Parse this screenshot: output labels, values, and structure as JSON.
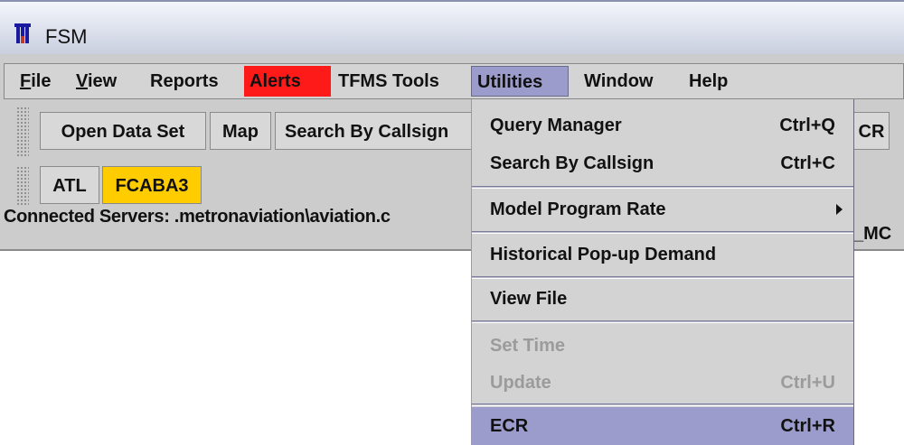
{
  "window": {
    "title": "FSM"
  },
  "menubar": {
    "items": [
      {
        "label": "File",
        "mnemonic_underline": true
      },
      {
        "label": "View",
        "mnemonic_underline": true
      },
      {
        "label": "Reports"
      },
      {
        "label": "Alerts"
      },
      {
        "label": "TFMS Tools"
      },
      {
        "label": "Utilities"
      },
      {
        "label": "Window"
      },
      {
        "label": "Help"
      }
    ]
  },
  "toolbar": {
    "open_data_set": "Open Data Set",
    "map": "Map",
    "search_by_callsign": "Search By Callsign",
    "ecr_partial": "CR"
  },
  "tabs": [
    {
      "label": "ATL"
    },
    {
      "label": "FCABA3"
    }
  ],
  "status": {
    "connected_servers": "Connected Servers: .metronaviation\\aviation.c",
    "right_fragment": "_MC"
  },
  "utilities_menu": {
    "items": [
      {
        "label": "Query Manager",
        "shortcut": "Ctrl+Q",
        "enabled": true
      },
      {
        "label": "Search By Callsign",
        "shortcut": "Ctrl+C",
        "enabled": true
      },
      {
        "label": "Model Program Rate",
        "shortcut": "",
        "enabled": true,
        "submenu": true
      },
      {
        "label": "Historical Pop-up Demand",
        "shortcut": "",
        "enabled": true
      },
      {
        "label": "View File",
        "shortcut": "",
        "enabled": true
      },
      {
        "label": "Set Time",
        "shortcut": "",
        "enabled": false
      },
      {
        "label": "Update",
        "shortcut": "Ctrl+U",
        "enabled": false
      },
      {
        "label": "ECR",
        "shortcut": "Ctrl+R",
        "enabled": true,
        "highlighted": true
      }
    ]
  },
  "colors": {
    "alerts_bg": "#ff1a1a",
    "active_menu_bg": "#9c9ccc",
    "active_tab_bg": "#ffcc00"
  }
}
